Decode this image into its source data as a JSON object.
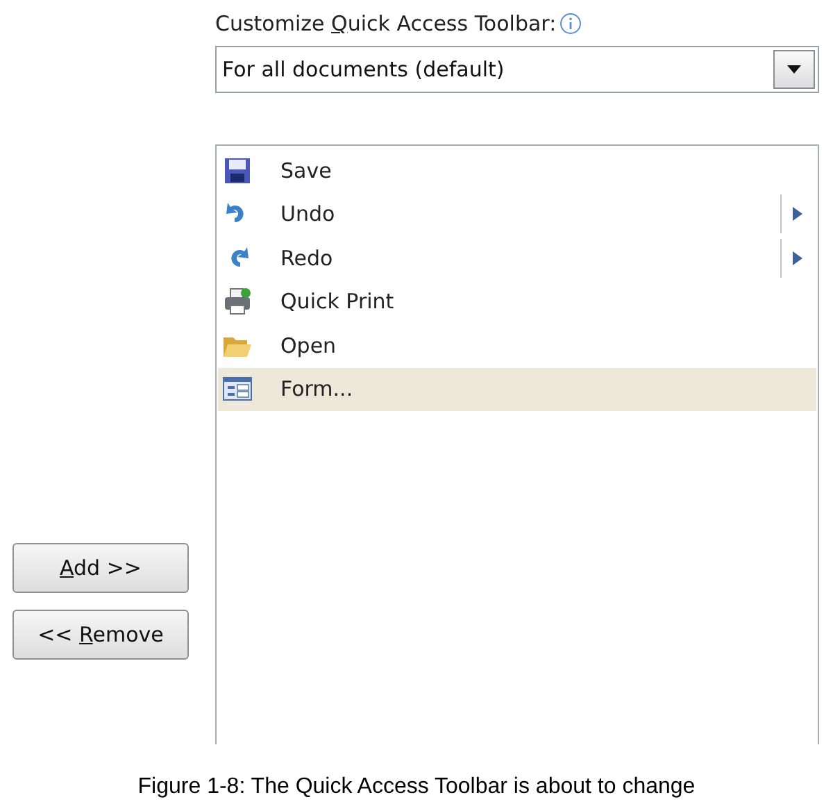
{
  "toolbar_label": {
    "parts": {
      "before": "Customize ",
      "key": "Q",
      "after": "uick Access Toolbar:"
    }
  },
  "scope_dropdown": {
    "value": "For all documents (default)"
  },
  "commands": [
    {
      "label": "Save",
      "kind": "save",
      "has_submenu": false,
      "selected": false
    },
    {
      "label": "Undo",
      "kind": "undo",
      "has_submenu": true,
      "selected": false
    },
    {
      "label": "Redo",
      "kind": "redo",
      "has_submenu": true,
      "selected": false
    },
    {
      "label": "Quick Print",
      "kind": "print",
      "has_submenu": false,
      "selected": false
    },
    {
      "label": "Open",
      "kind": "open",
      "has_submenu": false,
      "selected": false
    },
    {
      "label": "Form...",
      "kind": "form",
      "has_submenu": false,
      "selected": true
    }
  ],
  "buttons": [
    {
      "parts": {
        "key": "A",
        "after": "dd >>"
      }
    },
    {
      "parts": {
        "before": "<< ",
        "key": "R",
        "after": "emove"
      }
    }
  ],
  "caption": "Figure 1-8: The Quick Access Toolbar is about to change"
}
